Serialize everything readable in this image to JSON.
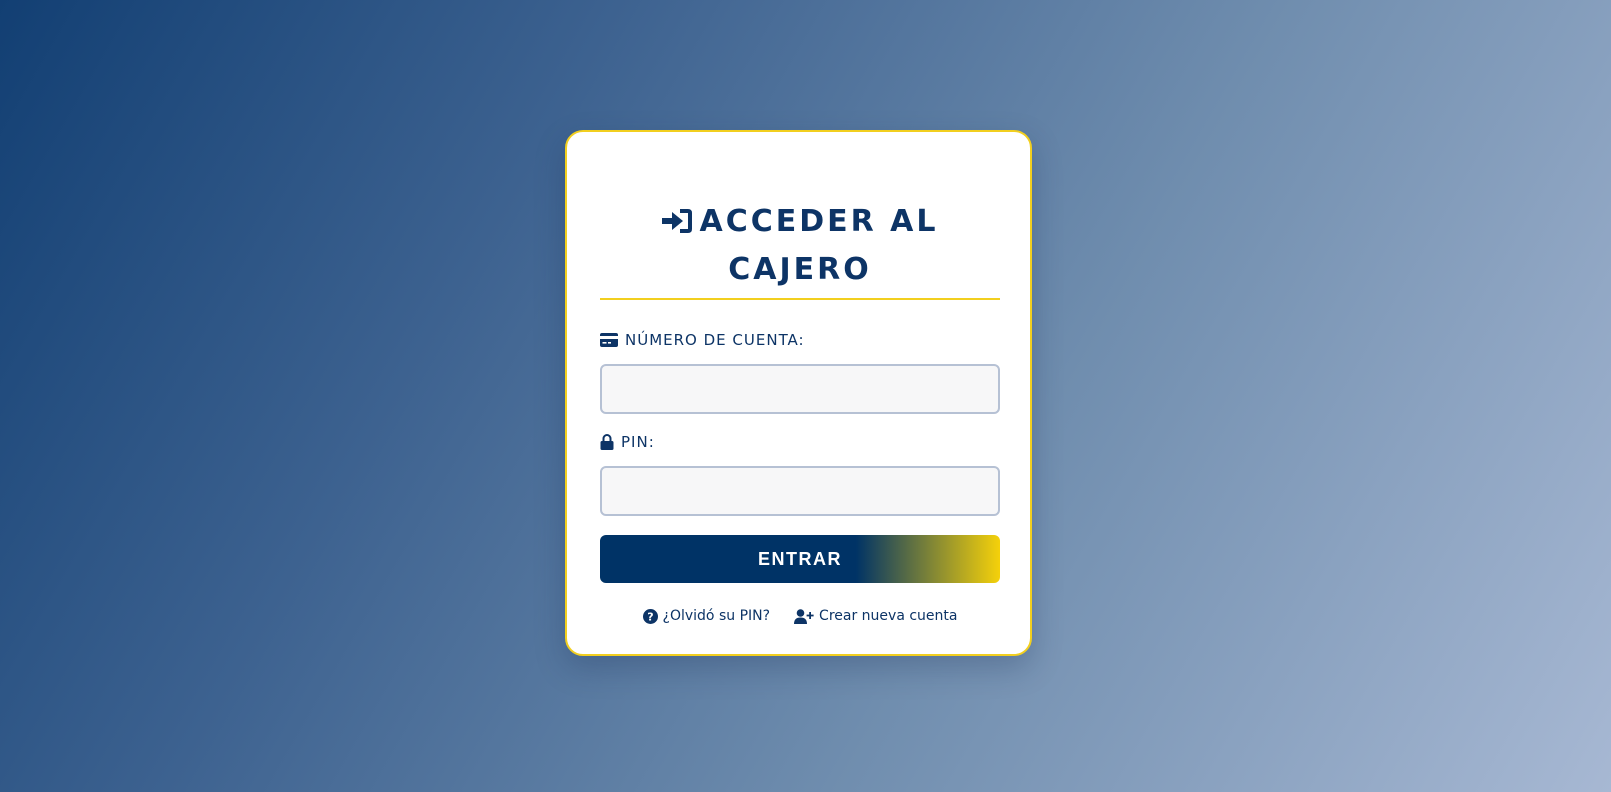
{
  "login": {
    "title": "ACCEDER AL CAJERO",
    "title_icon": "sign-in-icon",
    "account_label": "NÚMERO DE CUENTA:",
    "account_icon": "credit-card-icon",
    "account_value": "",
    "pin_label": "PIN:",
    "pin_icon": "lock-icon",
    "pin_value": "",
    "submit_label": "ENTRAR",
    "forgot_label": "¿Olvidó su PIN?",
    "forgot_icon": "question-circle-icon",
    "register_label": "Crear nueva cuenta",
    "register_icon": "user-plus-icon"
  },
  "colors": {
    "primary": "#0d3466",
    "accent": "#f2cf1f",
    "button_start": "#003366",
    "button_end": "#f5d10a",
    "input_bg": "#f7f7f8",
    "input_border": "#b6c1d4"
  }
}
